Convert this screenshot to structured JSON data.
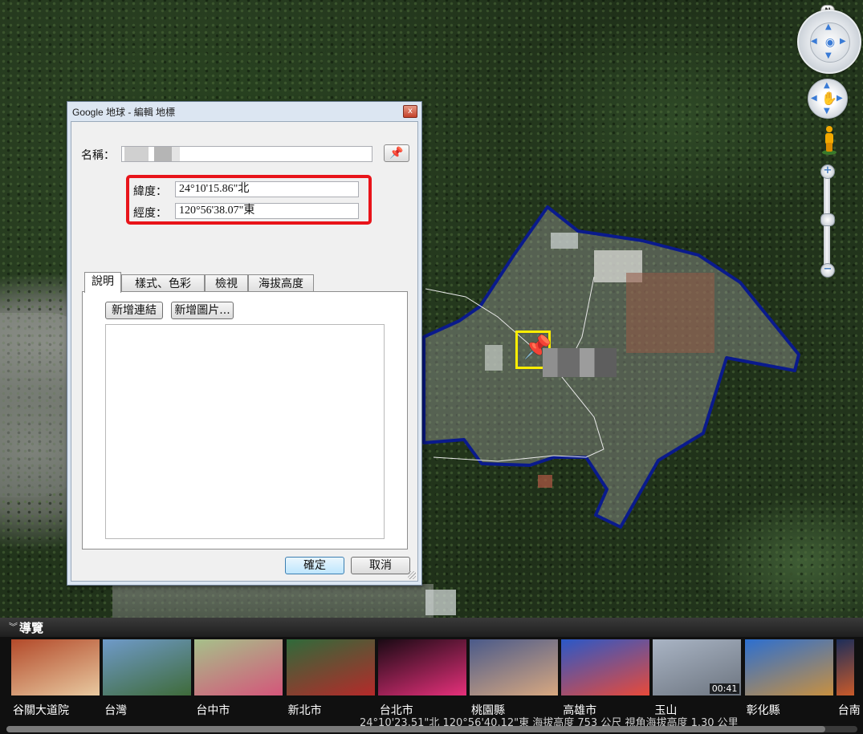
{
  "dialog": {
    "title": "Google 地球 - 編輯 地標",
    "close_glyph": "x",
    "name_label": "名稱：",
    "lat_label": "緯度：",
    "lat_value": "24°10'15.86\"北",
    "lon_label": "經度：",
    "lon_value": "120°56'38.07\"東",
    "tabs": [
      {
        "label": "說明",
        "active": true
      },
      {
        "label": "樣式、色彩",
        "active": false
      },
      {
        "label": "檢視",
        "active": false
      },
      {
        "label": "海拔高度",
        "active": false
      }
    ],
    "add_link": "新增連結",
    "add_image": "新增圖片...",
    "ok": "確定",
    "cancel": "取消"
  },
  "nav": {
    "north": "N",
    "zoom_in": "+",
    "zoom_out": "−"
  },
  "tour": {
    "title": "導覽",
    "items": [
      {
        "label": "谷關大道院",
        "colors": [
          "#b34a2a",
          "#e8c9a0"
        ]
      },
      {
        "label": "台灣",
        "colors": [
          "#6f9ac9",
          "#3f6b3a"
        ]
      },
      {
        "label": "台中市",
        "colors": [
          "#a6c08a",
          "#d4567a"
        ]
      },
      {
        "label": "新北市",
        "colors": [
          "#2f6a3a",
          "#b52a2a"
        ]
      },
      {
        "label": "台北市",
        "colors": [
          "#1a0a14",
          "#e5307a"
        ]
      },
      {
        "label": "桃園縣",
        "colors": [
          "#4a5a8a",
          "#d8a880"
        ]
      },
      {
        "label": "高雄市",
        "colors": [
          "#2a58c8",
          "#e84a3a"
        ]
      },
      {
        "label": "玉山",
        "colors": [
          "#a9b4c4",
          "#6d7580"
        ],
        "duration": "00:41"
      },
      {
        "label": "彰化縣",
        "colors": [
          "#2c6fd0",
          "#c89040"
        ]
      },
      {
        "label": "台南",
        "colors": [
          "#1d2e5a",
          "#c95a2a"
        ]
      }
    ]
  },
  "status_bar": {
    "text": "24°10'23.51\"北  120°56'40.12\"東  海拔高度  753 公尺   視角海拔高度  1.30 公里"
  },
  "colors": {
    "highlight": "#e8141a",
    "parcel_outline": "#0a1a8c",
    "placemark": "#ffee00"
  }
}
